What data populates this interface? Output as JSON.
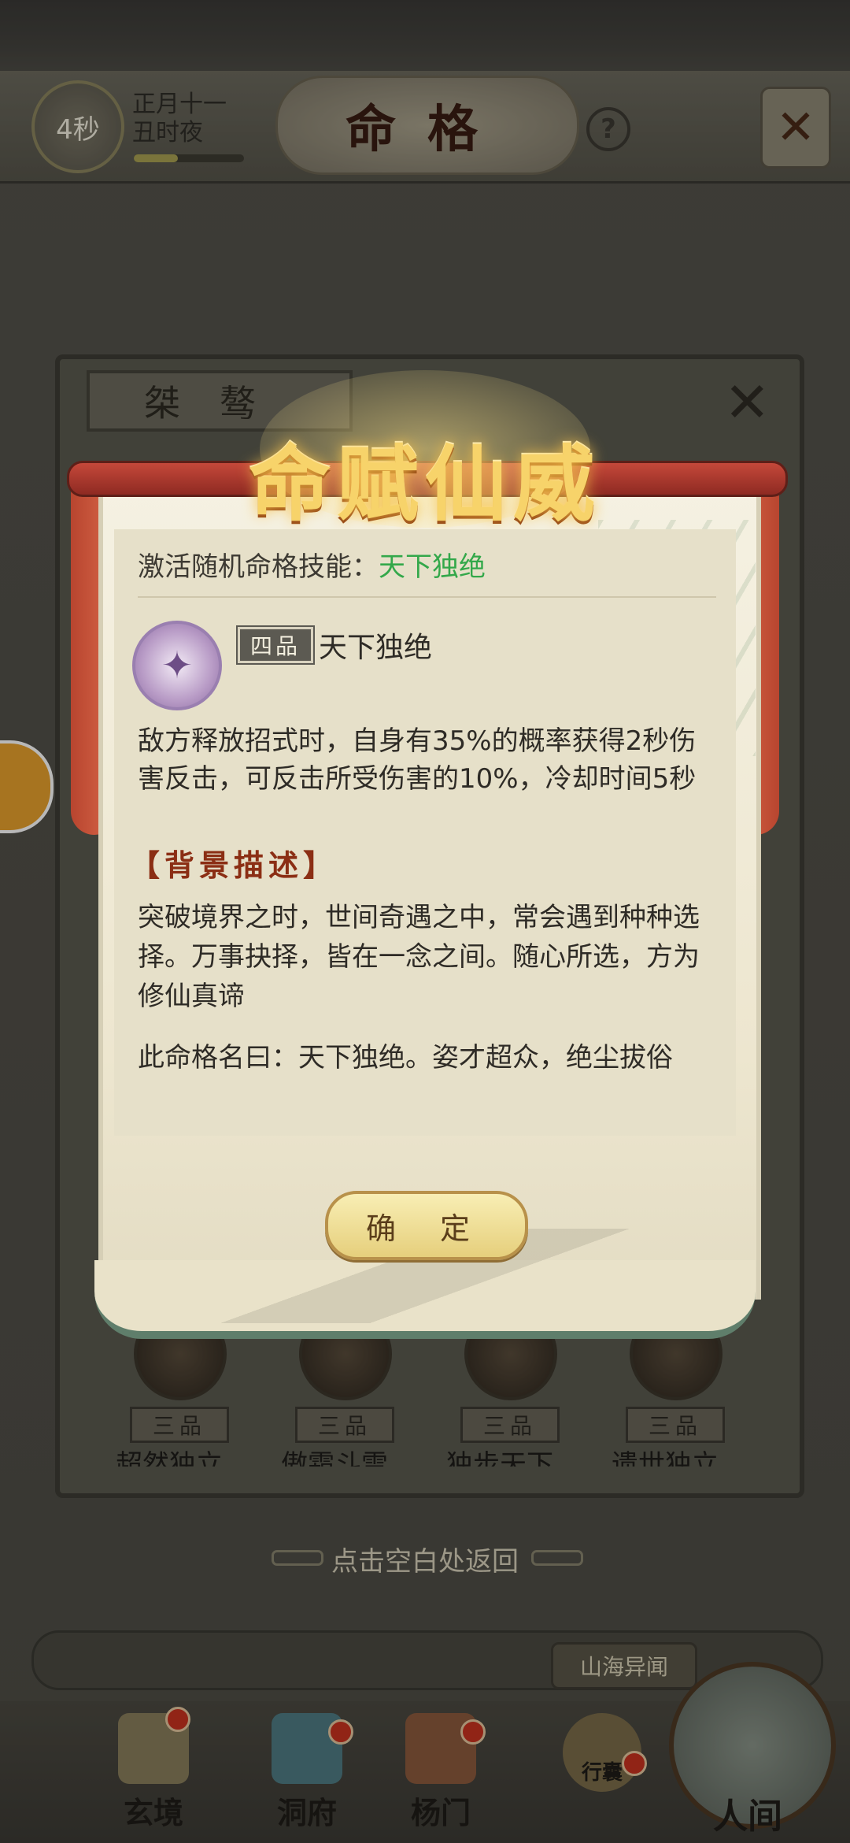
{
  "header": {
    "timer": "4秒",
    "day_line1": "正月十一",
    "day_line2": "丑时夜",
    "day_progress": 0.4,
    "title": "命格",
    "help": "?",
    "close": "✕"
  },
  "panel": {
    "tab_title": "桀骜",
    "close": "✕",
    "items": [
      {
        "grade": "三品",
        "name": "超然独立"
      },
      {
        "grade": "三品",
        "name": "傲霜斗雪"
      },
      {
        "grade": "三品",
        "name": "独步天下"
      },
      {
        "grade": "三品",
        "name": "遗世独立"
      }
    ]
  },
  "modal": {
    "title": "命赋仙威",
    "activate_label": "激活随机命格技能：",
    "activate_value": "天下独绝",
    "skill_grade": "四品",
    "skill_name": "天下独绝",
    "skill_desc": "敌方释放招式时，自身有35%的概率获得2秒伤害反击，可反击所受伤害的10%，冷却时间5秒",
    "background_title": "【背景描述】",
    "background_text1": "突破境界之时，世间奇遇之中，常会遇到种种选择。万事抉择，皆在一念之间。随心所选，方为修仙真谛",
    "background_text2": "此命格名曰：天下独绝。姿才超众，绝尘拔俗",
    "confirm": "确 定"
  },
  "hint": "点击空白处返回",
  "bottom_nav": {
    "shanhai": "山海异闻",
    "items": [
      {
        "label": "玄境"
      },
      {
        "label": "洞府"
      },
      {
        "label": "杨门"
      },
      {
        "label": "行囊"
      },
      {
        "label": "人间"
      }
    ]
  },
  "colors": {
    "accent_green": "#33a84a",
    "title_gold": "#f7d36a",
    "ribbon_red": "#c5483a"
  }
}
